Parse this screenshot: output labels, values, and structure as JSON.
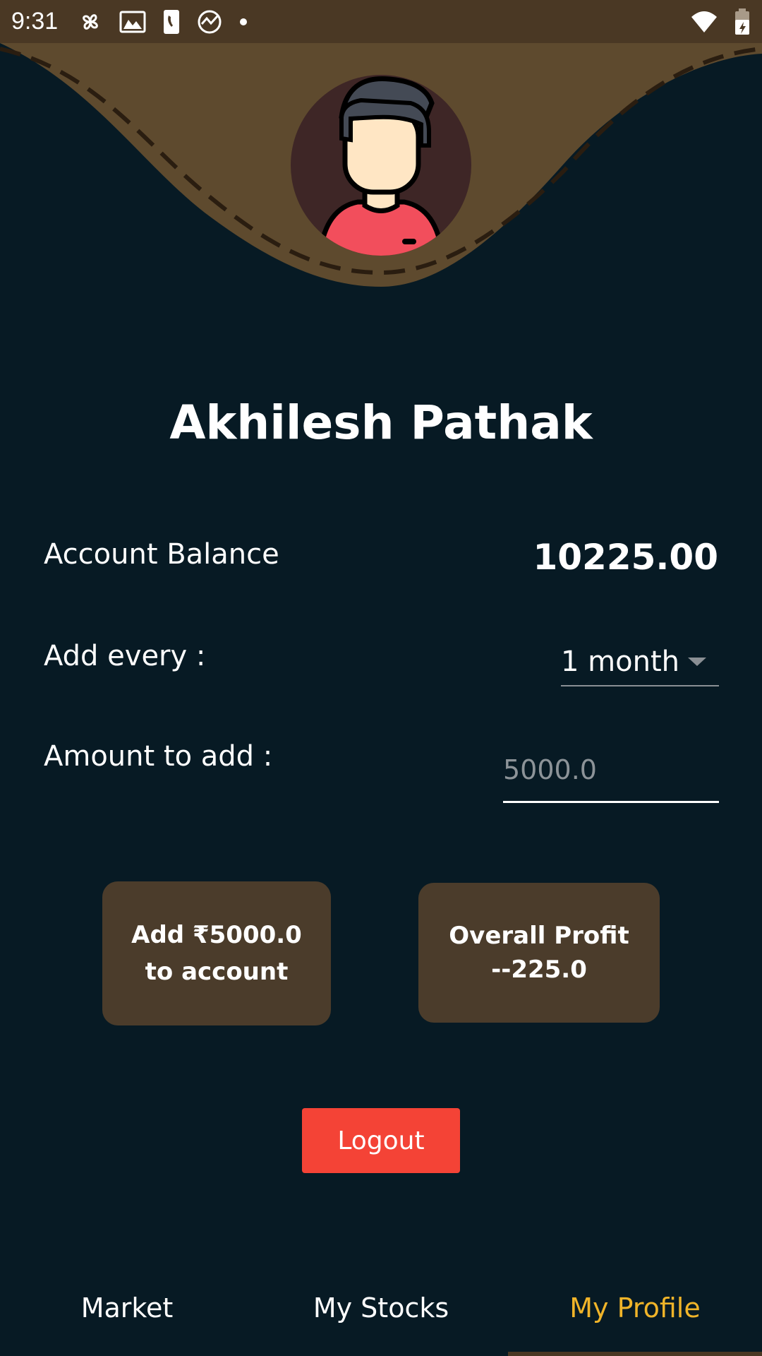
{
  "status_bar": {
    "time": "9:31",
    "icons": [
      "pinwheel-icon",
      "photo-icon",
      "phone-icon",
      "activity-icon",
      "dot-icon"
    ],
    "right_icons": [
      "wifi-icon",
      "battery-icon"
    ]
  },
  "profile": {
    "name": "Akhilesh Pathak",
    "avatar": "user-avatar-icon"
  },
  "account": {
    "balance_label": "Account Balance",
    "balance_value": "10225.00",
    "add_every_label": "Add every :",
    "add_every_value": "1 month",
    "amount_label": "Amount to add :",
    "amount_placeholder": "5000.0"
  },
  "actions": {
    "add_button_label": "Add ₹5000.0\nto account",
    "profit_label": "Overall Profit\n--225.0",
    "logout_label": "Logout"
  },
  "nav": {
    "tabs": [
      {
        "label": "Market",
        "active": false
      },
      {
        "label": "My Stocks",
        "active": false
      },
      {
        "label": "My Profile",
        "active": true
      }
    ]
  },
  "colors": {
    "background": "#071a24",
    "header": "#5e4a2e",
    "status_bar": "#4a3824",
    "card": "#4b3c2b",
    "logout": "#f44336",
    "active_tab": "#f0b429"
  }
}
